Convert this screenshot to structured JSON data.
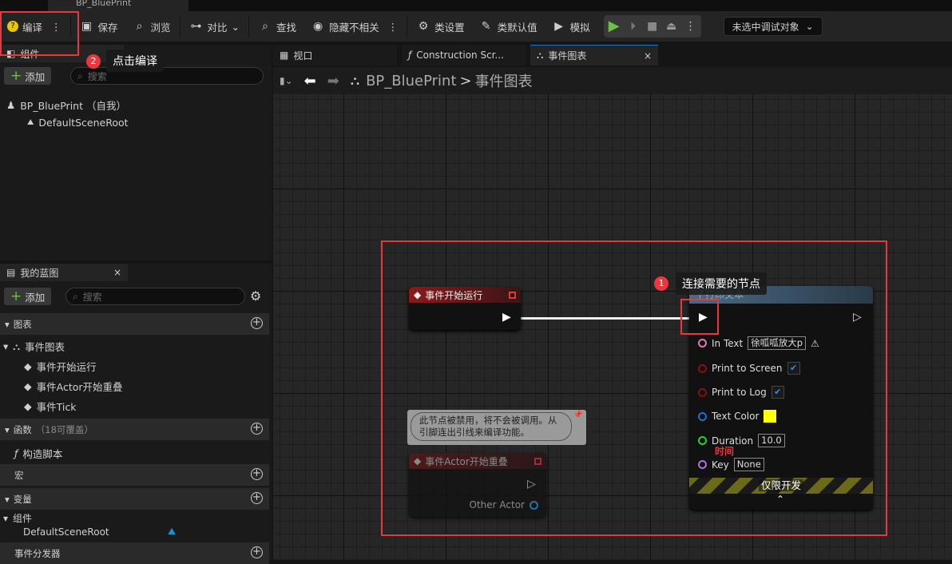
{
  "window": {
    "doc_tab": "BP_BluePrint"
  },
  "toolbar": {
    "compile": "编译",
    "save": "保存",
    "browse": "浏览",
    "diff": "对比",
    "find": "查找",
    "hide_unrelated": "隐藏不相关",
    "class_settings": "类设置",
    "class_defaults": "类默认值",
    "simulate": "模拟",
    "debug_object": "未选中调试对象"
  },
  "components_panel": {
    "title": "组件",
    "add": "添加",
    "search_placeholder": "搜索",
    "root": "BP_BluePrint （自我）",
    "child": "DefaultSceneRoot"
  },
  "graph_tabs": [
    {
      "label": "视口"
    },
    {
      "label": "Construction Scr..."
    },
    {
      "label": "事件图表"
    }
  ],
  "breadcrumb": {
    "blueprint": "BP_BluePrint",
    "separator": ">",
    "graph": "事件图表"
  },
  "my_blueprint": {
    "title": "我的蓝图",
    "add": "添加",
    "search_placeholder": "搜索",
    "graphs_section": "图表",
    "event_graph": "事件图表",
    "events": [
      "事件开始运行",
      "事件Actor开始重叠",
      "事件Tick"
    ],
    "functions_section": "函数",
    "functions_count": "（18可覆盖）",
    "construction_script": "构造脚本",
    "macros_section": "宏",
    "variables_section": "变量",
    "components_group": "组件",
    "component_var": "DefaultSceneRoot",
    "dispatchers_section": "事件分发器"
  },
  "nodes": {
    "begin_play": {
      "title": "事件开始运行"
    },
    "overlap": {
      "title": "事件Actor开始重叠",
      "pin": "Other Actor",
      "comment": "此节点被禁用，将不会被调用。从引脚连出引线来编译功能。"
    },
    "print": {
      "title": "打印文本",
      "in_text_label": "In Text",
      "in_text": "徐呱呱放大p",
      "print_screen": "Print to Screen",
      "print_log": "Print to Log",
      "text_color": "Text Color",
      "text_color_value": "#ffff00",
      "duration": "Duration",
      "duration_value": "10.0",
      "duration_note": "时间",
      "key": "Key",
      "key_value": "None",
      "dev_only": "仅限开发"
    }
  },
  "annotations": {
    "step1_num": "1",
    "step1": "连接需要的节点",
    "step2_num": "2",
    "step2": "点击编译"
  },
  "colors": {
    "accent_red": "#e8383d",
    "play_green": "#6cc04a"
  }
}
